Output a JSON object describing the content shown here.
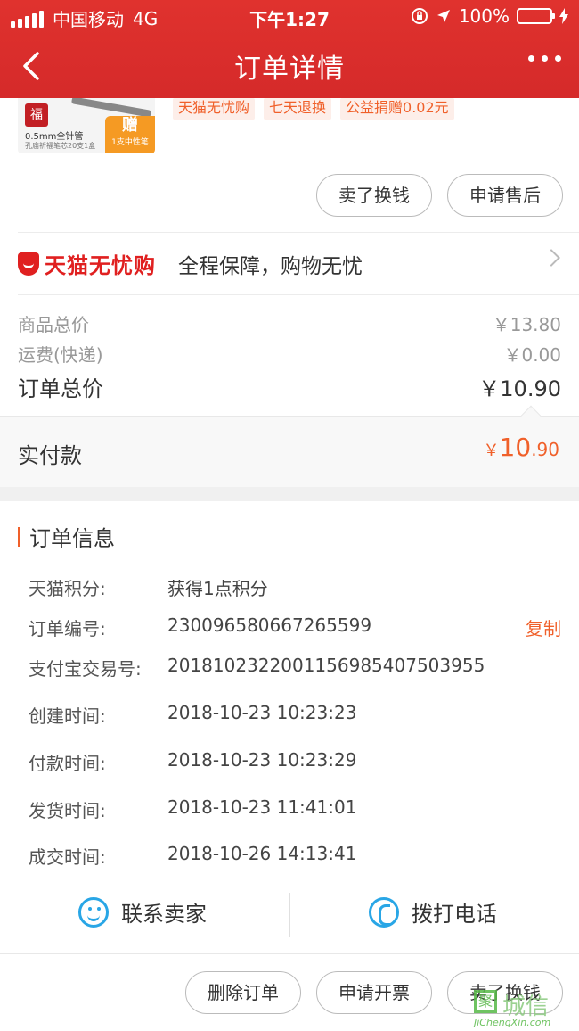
{
  "status_bar": {
    "carrier": "中国移动",
    "network": "4G",
    "time": "下午1:27",
    "battery": "100%"
  },
  "nav": {
    "title": "订单详情"
  },
  "product": {
    "thumb_badge": "福",
    "thumb_spec": "0.5mm全针管",
    "thumb_subspec": "孔庙祈福笔芯20支1盒",
    "thumb_gift": "赠",
    "thumb_gift_note": "1支中性笔",
    "tags": [
      "天猫无忧购",
      "七天退换",
      "公益捐赠0.02元"
    ]
  },
  "item_actions": {
    "sell_label": "卖了换钱",
    "aftersale_label": "申请售后"
  },
  "tmall_guarantee": {
    "brand": "天猫无忧购",
    "slogan": "全程保障，购物无忧"
  },
  "prices": {
    "goods_label": "商品总价",
    "goods_value": "￥13.80",
    "shipping_label": "运费(快递)",
    "shipping_value": "￥0.00",
    "total_label": "订单总价",
    "total_value": "￥10.90",
    "paid_label": "实付款",
    "paid_yen": "￥",
    "paid_int": "10",
    "paid_dec": ".90"
  },
  "order_info": {
    "title": "订单信息",
    "rows": [
      {
        "key": "天猫积分:",
        "value": "获得1点积分"
      },
      {
        "key": "订单编号:",
        "value": "230096580667265599"
      },
      {
        "key": "支付宝交易号:",
        "value": "2018102322001156985407503955"
      },
      {
        "key": "创建时间:",
        "value": "2018-10-23 10:23:23"
      },
      {
        "key": "付款时间:",
        "value": "2018-10-23 10:23:29"
      },
      {
        "key": "发货时间:",
        "value": "2018-10-23 11:41:01"
      },
      {
        "key": "成交时间:",
        "value": "2018-10-26 14:13:41"
      }
    ],
    "copy_label": "复制"
  },
  "contact": {
    "seller_label": "联系卖家",
    "call_label": "拨打电话"
  },
  "bottom_actions": {
    "delete_label": "删除订单",
    "invoice_label": "申请开票",
    "sell_label": "卖了换钱"
  },
  "watermark": {
    "cn": "城信",
    "box": "聚",
    "en": "JiChengXin.com"
  },
  "colors": {
    "brand_red": "#e0322e",
    "accent_orange": "#f0602a",
    "contact_blue": "#29a6e6"
  }
}
